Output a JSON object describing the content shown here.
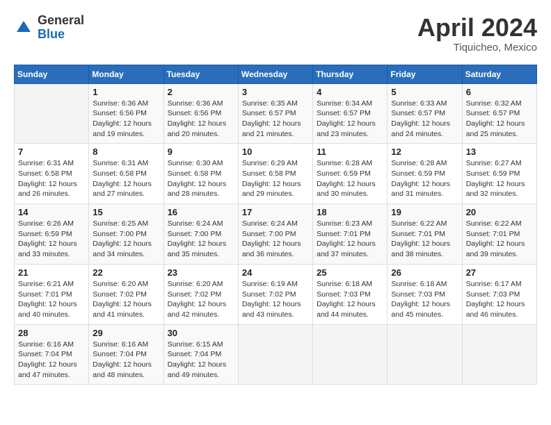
{
  "header": {
    "logo_general": "General",
    "logo_blue": "Blue",
    "month_title": "April 2024",
    "subtitle": "Tiquicheo, Mexico"
  },
  "calendar": {
    "days_of_week": [
      "Sunday",
      "Monday",
      "Tuesday",
      "Wednesday",
      "Thursday",
      "Friday",
      "Saturday"
    ],
    "weeks": [
      [
        {
          "day": "",
          "sunrise": "",
          "sunset": "",
          "daylight": ""
        },
        {
          "day": "1",
          "sunrise": "Sunrise: 6:36 AM",
          "sunset": "Sunset: 6:56 PM",
          "daylight": "Daylight: 12 hours and 19 minutes."
        },
        {
          "day": "2",
          "sunrise": "Sunrise: 6:36 AM",
          "sunset": "Sunset: 6:56 PM",
          "daylight": "Daylight: 12 hours and 20 minutes."
        },
        {
          "day": "3",
          "sunrise": "Sunrise: 6:35 AM",
          "sunset": "Sunset: 6:57 PM",
          "daylight": "Daylight: 12 hours and 21 minutes."
        },
        {
          "day": "4",
          "sunrise": "Sunrise: 6:34 AM",
          "sunset": "Sunset: 6:57 PM",
          "daylight": "Daylight: 12 hours and 23 minutes."
        },
        {
          "day": "5",
          "sunrise": "Sunrise: 6:33 AM",
          "sunset": "Sunset: 6:57 PM",
          "daylight": "Daylight: 12 hours and 24 minutes."
        },
        {
          "day": "6",
          "sunrise": "Sunrise: 6:32 AM",
          "sunset": "Sunset: 6:57 PM",
          "daylight": "Daylight: 12 hours and 25 minutes."
        }
      ],
      [
        {
          "day": "7",
          "sunrise": "Sunrise: 6:31 AM",
          "sunset": "Sunset: 6:58 PM",
          "daylight": "Daylight: 12 hours and 26 minutes."
        },
        {
          "day": "8",
          "sunrise": "Sunrise: 6:31 AM",
          "sunset": "Sunset: 6:58 PM",
          "daylight": "Daylight: 12 hours and 27 minutes."
        },
        {
          "day": "9",
          "sunrise": "Sunrise: 6:30 AM",
          "sunset": "Sunset: 6:58 PM",
          "daylight": "Daylight: 12 hours and 28 minutes."
        },
        {
          "day": "10",
          "sunrise": "Sunrise: 6:29 AM",
          "sunset": "Sunset: 6:58 PM",
          "daylight": "Daylight: 12 hours and 29 minutes."
        },
        {
          "day": "11",
          "sunrise": "Sunrise: 6:28 AM",
          "sunset": "Sunset: 6:59 PM",
          "daylight": "Daylight: 12 hours and 30 minutes."
        },
        {
          "day": "12",
          "sunrise": "Sunrise: 6:28 AM",
          "sunset": "Sunset: 6:59 PM",
          "daylight": "Daylight: 12 hours and 31 minutes."
        },
        {
          "day": "13",
          "sunrise": "Sunrise: 6:27 AM",
          "sunset": "Sunset: 6:59 PM",
          "daylight": "Daylight: 12 hours and 32 minutes."
        }
      ],
      [
        {
          "day": "14",
          "sunrise": "Sunrise: 6:26 AM",
          "sunset": "Sunset: 6:59 PM",
          "daylight": "Daylight: 12 hours and 33 minutes."
        },
        {
          "day": "15",
          "sunrise": "Sunrise: 6:25 AM",
          "sunset": "Sunset: 7:00 PM",
          "daylight": "Daylight: 12 hours and 34 minutes."
        },
        {
          "day": "16",
          "sunrise": "Sunrise: 6:24 AM",
          "sunset": "Sunset: 7:00 PM",
          "daylight": "Daylight: 12 hours and 35 minutes."
        },
        {
          "day": "17",
          "sunrise": "Sunrise: 6:24 AM",
          "sunset": "Sunset: 7:00 PM",
          "daylight": "Daylight: 12 hours and 36 minutes."
        },
        {
          "day": "18",
          "sunrise": "Sunrise: 6:23 AM",
          "sunset": "Sunset: 7:01 PM",
          "daylight": "Daylight: 12 hours and 37 minutes."
        },
        {
          "day": "19",
          "sunrise": "Sunrise: 6:22 AM",
          "sunset": "Sunset: 7:01 PM",
          "daylight": "Daylight: 12 hours and 38 minutes."
        },
        {
          "day": "20",
          "sunrise": "Sunrise: 6:22 AM",
          "sunset": "Sunset: 7:01 PM",
          "daylight": "Daylight: 12 hours and 39 minutes."
        }
      ],
      [
        {
          "day": "21",
          "sunrise": "Sunrise: 6:21 AM",
          "sunset": "Sunset: 7:01 PM",
          "daylight": "Daylight: 12 hours and 40 minutes."
        },
        {
          "day": "22",
          "sunrise": "Sunrise: 6:20 AM",
          "sunset": "Sunset: 7:02 PM",
          "daylight": "Daylight: 12 hours and 41 minutes."
        },
        {
          "day": "23",
          "sunrise": "Sunrise: 6:20 AM",
          "sunset": "Sunset: 7:02 PM",
          "daylight": "Daylight: 12 hours and 42 minutes."
        },
        {
          "day": "24",
          "sunrise": "Sunrise: 6:19 AM",
          "sunset": "Sunset: 7:02 PM",
          "daylight": "Daylight: 12 hours and 43 minutes."
        },
        {
          "day": "25",
          "sunrise": "Sunrise: 6:18 AM",
          "sunset": "Sunset: 7:03 PM",
          "daylight": "Daylight: 12 hours and 44 minutes."
        },
        {
          "day": "26",
          "sunrise": "Sunrise: 6:18 AM",
          "sunset": "Sunset: 7:03 PM",
          "daylight": "Daylight: 12 hours and 45 minutes."
        },
        {
          "day": "27",
          "sunrise": "Sunrise: 6:17 AM",
          "sunset": "Sunset: 7:03 PM",
          "daylight": "Daylight: 12 hours and 46 minutes."
        }
      ],
      [
        {
          "day": "28",
          "sunrise": "Sunrise: 6:16 AM",
          "sunset": "Sunset: 7:04 PM",
          "daylight": "Daylight: 12 hours and 47 minutes."
        },
        {
          "day": "29",
          "sunrise": "Sunrise: 6:16 AM",
          "sunset": "Sunset: 7:04 PM",
          "daylight": "Daylight: 12 hours and 48 minutes."
        },
        {
          "day": "30",
          "sunrise": "Sunrise: 6:15 AM",
          "sunset": "Sunset: 7:04 PM",
          "daylight": "Daylight: 12 hours and 49 minutes."
        },
        {
          "day": "",
          "sunrise": "",
          "sunset": "",
          "daylight": ""
        },
        {
          "day": "",
          "sunrise": "",
          "sunset": "",
          "daylight": ""
        },
        {
          "day": "",
          "sunrise": "",
          "sunset": "",
          "daylight": ""
        },
        {
          "day": "",
          "sunrise": "",
          "sunset": "",
          "daylight": ""
        }
      ]
    ]
  }
}
